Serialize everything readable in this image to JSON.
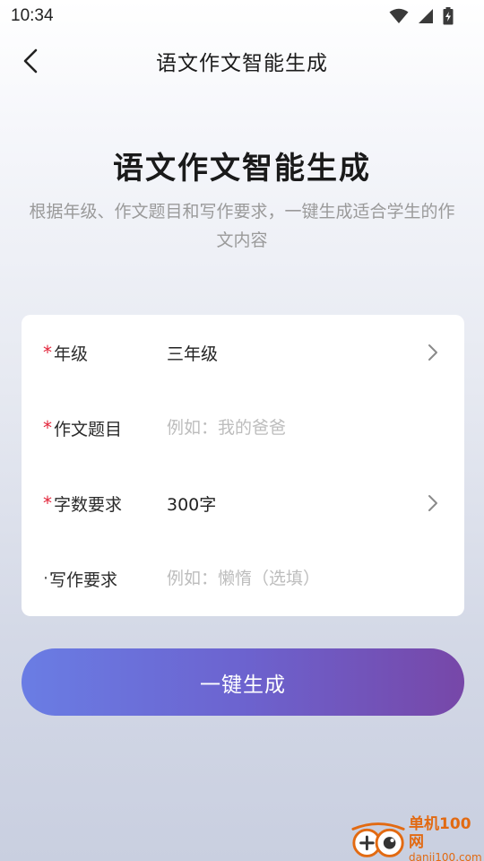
{
  "status_bar": {
    "time": "10:34",
    "icons": [
      "wifi-icon",
      "signal-icon",
      "battery-icon"
    ]
  },
  "nav": {
    "title": "语文作文智能生成",
    "back_icon": "chevron-left-icon"
  },
  "hero": {
    "title": "语文作文智能生成",
    "subtitle": "根据年级、作文题目和写作要求，一键生成适合学生的作文内容"
  },
  "form": {
    "rows": [
      {
        "required_mark": "*",
        "label": "年级",
        "value": "三年级",
        "has_chevron": true
      },
      {
        "required_mark": "*",
        "label": "作文题目",
        "placeholder": "例如：我的爸爸"
      },
      {
        "required_mark": "*",
        "label": "字数要求",
        "value": "300字",
        "has_chevron": true
      },
      {
        "optional_mark": "·",
        "label": "写作要求",
        "placeholder": "例如：懒惰（选填）"
      }
    ]
  },
  "generate_button": {
    "label": "一键生成"
  },
  "watermark": {
    "name": "单机100网",
    "url": "danji100.com"
  },
  "colors": {
    "required": "#e3263b",
    "button_start": "#6a7de4",
    "button_end": "#7747a8",
    "placeholder": "#bdbdbd",
    "watermark": "#e26a12"
  }
}
